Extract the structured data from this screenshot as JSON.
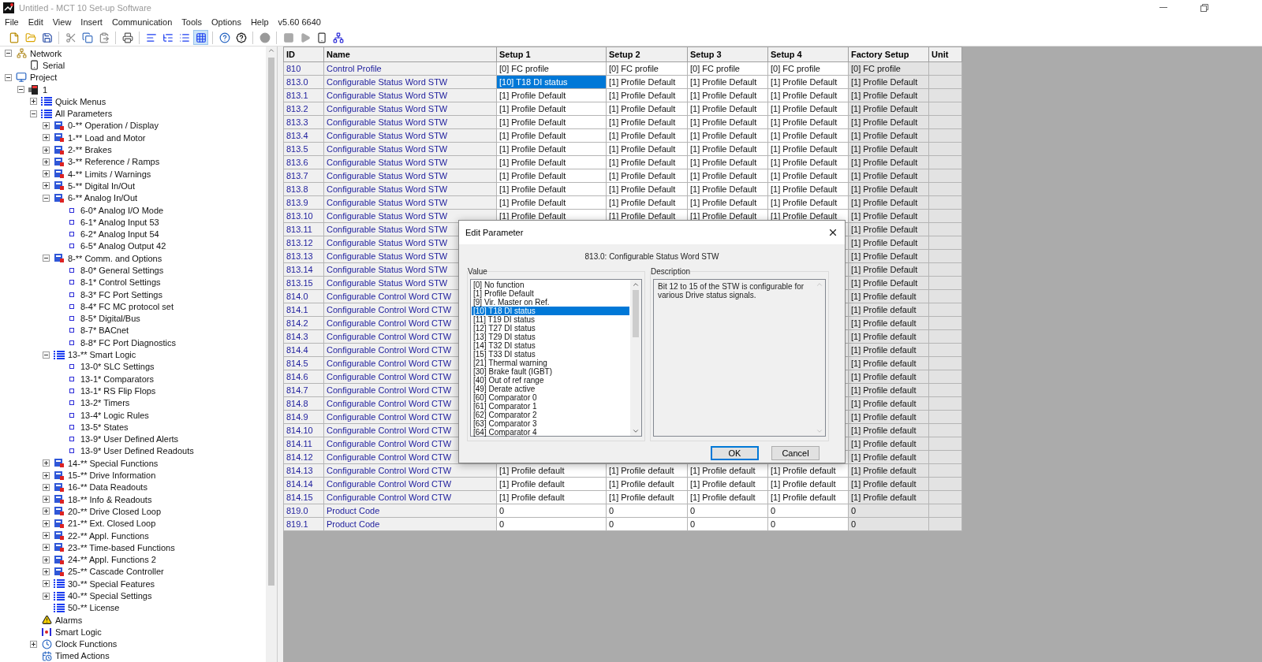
{
  "window": {
    "title": "Untitled - MCT 10 Set-up Software"
  },
  "menu": [
    "File",
    "Edit",
    "View",
    "Insert",
    "Communication",
    "Tools",
    "Options",
    "Help",
    "v5.60 6640"
  ],
  "toolbar": {
    "views": [
      {
        "selected": false
      },
      {
        "selected": false
      },
      {
        "selected": false
      },
      {
        "selected": true
      }
    ]
  },
  "tree": [
    {
      "label": "Network",
      "kind": "network",
      "expanded": true,
      "children": [
        {
          "label": "Serial",
          "kind": "device"
        }
      ]
    },
    {
      "label": "Project",
      "kind": "project",
      "expanded": true,
      "children": [
        {
          "label": "1",
          "kind": "drive",
          "expanded": true,
          "children": [
            {
              "label": "Quick Menus",
              "kind": "list",
              "expanded": false
            },
            {
              "label": "All Parameters",
              "kind": "list",
              "expanded": true,
              "children": [
                {
                  "label": "0-** Operation / Display",
                  "kind": "group",
                  "expanded": false
                },
                {
                  "label": "1-** Load and Motor",
                  "kind": "group",
                  "expanded": false
                },
                {
                  "label": "2-** Brakes",
                  "kind": "group",
                  "expanded": false
                },
                {
                  "label": "3-** Reference / Ramps",
                  "kind": "group",
                  "expanded": false
                },
                {
                  "label": "4-** Limits / Warnings",
                  "kind": "group",
                  "expanded": false
                },
                {
                  "label": "5-** Digital In/Out",
                  "kind": "group",
                  "expanded": false
                },
                {
                  "label": "6-** Analog In/Out",
                  "kind": "group",
                  "expanded": true,
                  "children": [
                    {
                      "label": "6-0* Analog I/O Mode",
                      "kind": "leaf"
                    },
                    {
                      "label": "6-1* Analog Input 53",
                      "kind": "leaf"
                    },
                    {
                      "label": "6-2* Analog Input 54",
                      "kind": "leaf"
                    },
                    {
                      "label": "6-5* Analog Output 42",
                      "kind": "leaf"
                    }
                  ]
                },
                {
                  "label": "8-** Comm. and Options",
                  "kind": "group",
                  "expanded": true,
                  "children": [
                    {
                      "label": "8-0* General Settings",
                      "kind": "leaf"
                    },
                    {
                      "label": "8-1* Control Settings",
                      "kind": "leaf"
                    },
                    {
                      "label": "8-3* FC Port Settings",
                      "kind": "leaf"
                    },
                    {
                      "label": "8-4* FC MC protocol set",
                      "kind": "leaf"
                    },
                    {
                      "label": "8-5* Digital/Bus",
                      "kind": "leaf"
                    },
                    {
                      "label": "8-7* BACnet",
                      "kind": "leaf"
                    },
                    {
                      "label": "8-8* FC Port Diagnostics",
                      "kind": "leaf"
                    }
                  ]
                },
                {
                  "label": "13-** Smart Logic",
                  "kind": "list",
                  "expanded": true,
                  "children": [
                    {
                      "label": "13-0* SLC Settings",
                      "kind": "leaf"
                    },
                    {
                      "label": "13-1* Comparators",
                      "kind": "leaf"
                    },
                    {
                      "label": "13-1* RS Flip Flops",
                      "kind": "leaf"
                    },
                    {
                      "label": "13-2* Timers",
                      "kind": "leaf"
                    },
                    {
                      "label": "13-4* Logic Rules",
                      "kind": "leaf"
                    },
                    {
                      "label": "13-5* States",
                      "kind": "leaf"
                    },
                    {
                      "label": "13-9* User Defined Alerts",
                      "kind": "leaf"
                    },
                    {
                      "label": "13-9* User Defined Readouts",
                      "kind": "leaf"
                    }
                  ]
                },
                {
                  "label": "14-** Special Functions",
                  "kind": "group",
                  "expanded": false
                },
                {
                  "label": "15-** Drive Information",
                  "kind": "group",
                  "expanded": false
                },
                {
                  "label": "16-** Data Readouts",
                  "kind": "group",
                  "expanded": false
                },
                {
                  "label": "18-** Info & Readouts",
                  "kind": "group",
                  "expanded": false
                },
                {
                  "label": "20-** Drive Closed Loop",
                  "kind": "group",
                  "expanded": false
                },
                {
                  "label": "21-** Ext. Closed Loop",
                  "kind": "group",
                  "expanded": false
                },
                {
                  "label": "22-** Appl. Functions",
                  "kind": "group",
                  "expanded": false
                },
                {
                  "label": "23-** Time-based Functions",
                  "kind": "group",
                  "expanded": false
                },
                {
                  "label": "24-** Appl. Functions 2",
                  "kind": "group",
                  "expanded": false
                },
                {
                  "label": "25-** Cascade Controller",
                  "kind": "group",
                  "expanded": false
                },
                {
                  "label": "30-** Special Features",
                  "kind": "list",
                  "expanded": false
                },
                {
                  "label": "40-** Special Settings",
                  "kind": "list",
                  "expanded": false
                },
                {
                  "label": "50-** License",
                  "kind": "list"
                }
              ]
            },
            {
              "label": "Alarms",
              "kind": "alarm"
            },
            {
              "label": "Smart Logic",
              "kind": "logic"
            },
            {
              "label": "Clock Functions",
              "kind": "clock",
              "expanded": false
            },
            {
              "label": "Timed Actions",
              "kind": "timed"
            }
          ]
        }
      ]
    }
  ],
  "table": {
    "columns": [
      "ID",
      "Name",
      "Setup 1",
      "Setup 2",
      "Setup 3",
      "Setup 4",
      "Factory Setup",
      "Unit"
    ],
    "rows": [
      {
        "id": "810",
        "name": "Control Profile",
        "setups": [
          {
            "text": "[0] FC profile",
            "selected": false
          },
          {
            "text": "[0] FC profile",
            "selected": false
          },
          {
            "text": "[0] FC profile",
            "selected": false
          },
          {
            "text": "[0] FC profile",
            "selected": false
          }
        ],
        "factory": "[0] FC profile"
      },
      {
        "id": "813.0",
        "name": "Configurable Status Word STW",
        "setups": [
          {
            "text": "[10] T18 DI status",
            "selected": true
          },
          {
            "text": "[1] Profile Default",
            "selected": false
          },
          {
            "text": "[1] Profile Default",
            "selected": false
          },
          {
            "text": "[1] Profile Default",
            "selected": false
          }
        ],
        "factory": "[1] Profile Default"
      },
      {
        "id": "813.1",
        "name": "Configurable Status Word STW",
        "setups": [
          {
            "text": "[1] Profile Default",
            "selected": false
          },
          {
            "text": "[1] Profile Default",
            "selected": false
          },
          {
            "text": "[1] Profile Default",
            "selected": false
          },
          {
            "text": "[1] Profile Default",
            "selected": false
          }
        ],
        "factory": "[1] Profile Default"
      },
      {
        "id": "813.2",
        "name": "Configurable Status Word STW",
        "setups": [
          {
            "text": "[1] Profile Default",
            "selected": false
          },
          {
            "text": "[1] Profile Default",
            "selected": false
          },
          {
            "text": "[1] Profile Default",
            "selected": false
          },
          {
            "text": "[1] Profile Default",
            "selected": false
          }
        ],
        "factory": "[1] Profile Default"
      },
      {
        "id": "813.3",
        "name": "Configurable Status Word STW",
        "setups": [
          {
            "text": "[1] Profile Default",
            "selected": false
          },
          {
            "text": "[1] Profile Default",
            "selected": false
          },
          {
            "text": "[1] Profile Default",
            "selected": false
          },
          {
            "text": "[1] Profile Default",
            "selected": false
          }
        ],
        "factory": "[1] Profile Default"
      },
      {
        "id": "813.4",
        "name": "Configurable Status Word STW",
        "setups": [
          {
            "text": "[1] Profile Default",
            "selected": false
          },
          {
            "text": "[1] Profile Default",
            "selected": false
          },
          {
            "text": "[1] Profile Default",
            "selected": false
          },
          {
            "text": "[1] Profile Default",
            "selected": false
          }
        ],
        "factory": "[1] Profile Default"
      },
      {
        "id": "813.5",
        "name": "Configurable Status Word STW",
        "setups": [
          {
            "text": "[1] Profile Default",
            "selected": false
          },
          {
            "text": "[1] Profile Default",
            "selected": false
          },
          {
            "text": "[1] Profile Default",
            "selected": false
          },
          {
            "text": "[1] Profile Default",
            "selected": false
          }
        ],
        "factory": "[1] Profile Default"
      },
      {
        "id": "813.6",
        "name": "Configurable Status Word STW",
        "setups": [
          {
            "text": "[1] Profile Default",
            "selected": false
          },
          {
            "text": "[1] Profile Default",
            "selected": false
          },
          {
            "text": "[1] Profile Default",
            "selected": false
          },
          {
            "text": "[1] Profile Default",
            "selected": false
          }
        ],
        "factory": "[1] Profile Default"
      },
      {
        "id": "813.7",
        "name": "Configurable Status Word STW",
        "setups": [
          {
            "text": "[1] Profile Default",
            "selected": false
          },
          {
            "text": "[1] Profile Default",
            "selected": false
          },
          {
            "text": "[1] Profile Default",
            "selected": false
          },
          {
            "text": "[1] Profile Default",
            "selected": false
          }
        ],
        "factory": "[1] Profile Default"
      },
      {
        "id": "813.8",
        "name": "Configurable Status Word STW",
        "setups": [
          {
            "text": "[1] Profile Default",
            "selected": false
          },
          {
            "text": "[1] Profile Default",
            "selected": false
          },
          {
            "text": "[1] Profile Default",
            "selected": false
          },
          {
            "text": "[1] Profile Default",
            "selected": false
          }
        ],
        "factory": "[1] Profile Default"
      },
      {
        "id": "813.9",
        "name": "Configurable Status Word STW",
        "setups": [
          {
            "text": "[1] Profile Default",
            "selected": false
          },
          {
            "text": "[1] Profile Default",
            "selected": false
          },
          {
            "text": "[1] Profile Default",
            "selected": false
          },
          {
            "text": "[1] Profile Default",
            "selected": false
          }
        ],
        "factory": "[1] Profile Default"
      },
      {
        "id": "813.10",
        "name": "Configurable Status Word STW",
        "setups": [
          {
            "text": "[1] Profile Default",
            "selected": false
          },
          {
            "text": "[1] Profile Default",
            "selected": false
          },
          {
            "text": "[1] Profile Default",
            "selected": false
          },
          {
            "text": "[1] Profile Default",
            "selected": false
          }
        ],
        "factory": "[1] Profile Default"
      },
      {
        "id": "813.11",
        "name": "Configurable Status Word STW",
        "factory": "[1] Profile Default"
      },
      {
        "id": "813.12",
        "name": "Configurable Status Word STW",
        "factory": "[1] Profile Default"
      },
      {
        "id": "813.13",
        "name": "Configurable Status Word STW",
        "factory": "[1] Profile Default"
      },
      {
        "id": "813.14",
        "name": "Configurable Status Word STW",
        "factory": "[1] Profile Default"
      },
      {
        "id": "813.15",
        "name": "Configurable Status Word STW",
        "factory": "[1] Profile Default"
      },
      {
        "id": "814.0",
        "name": "Configurable Control Word CTW",
        "factory": "[1] Profile default"
      },
      {
        "id": "814.1",
        "name": "Configurable Control Word CTW",
        "factory": "[1] Profile default"
      },
      {
        "id": "814.2",
        "name": "Configurable Control Word CTW",
        "factory": "[1] Profile default"
      },
      {
        "id": "814.3",
        "name": "Configurable Control Word CTW",
        "factory": "[1] Profile default"
      },
      {
        "id": "814.4",
        "name": "Configurable Control Word CTW",
        "factory": "[1] Profile default"
      },
      {
        "id": "814.5",
        "name": "Configurable Control Word CTW",
        "factory": "[1] Profile default"
      },
      {
        "id": "814.6",
        "name": "Configurable Control Word CTW",
        "factory": "[1] Profile default"
      },
      {
        "id": "814.7",
        "name": "Configurable Control Word CTW",
        "factory": "[1] Profile default"
      },
      {
        "id": "814.8",
        "name": "Configurable Control Word CTW",
        "factory": "[1] Profile default"
      },
      {
        "id": "814.9",
        "name": "Configurable Control Word CTW",
        "factory": "[1] Profile default"
      },
      {
        "id": "814.10",
        "name": "Configurable Control Word CTW",
        "factory": "[1] Profile default"
      },
      {
        "id": "814.11",
        "name": "Configurable Control Word CTW",
        "factory": "[1] Profile default"
      },
      {
        "id": "814.12",
        "name": "Configurable Control Word CTW",
        "factory": "[1] Profile default"
      },
      {
        "id": "814.13",
        "name": "Configurable Control Word CTW",
        "setups": [
          {
            "text": "[1] Profile default",
            "selected": false
          },
          {
            "text": "[1] Profile default",
            "selected": false
          },
          {
            "text": "[1] Profile default",
            "selected": false
          },
          {
            "text": "[1] Profile default",
            "selected": false
          }
        ],
        "factory": "[1] Profile default"
      },
      {
        "id": "814.14",
        "name": "Configurable Control Word CTW",
        "setups": [
          {
            "text": "[1] Profile default",
            "selected": false
          },
          {
            "text": "[1] Profile default",
            "selected": false
          },
          {
            "text": "[1] Profile default",
            "selected": false
          },
          {
            "text": "[1] Profile default",
            "selected": false
          }
        ],
        "factory": "[1] Profile default"
      },
      {
        "id": "814.15",
        "name": "Configurable Control Word CTW",
        "setups": [
          {
            "text": "[1] Profile default",
            "selected": false
          },
          {
            "text": "[1] Profile default",
            "selected": false
          },
          {
            "text": "[1] Profile default",
            "selected": false
          },
          {
            "text": "[1] Profile default",
            "selected": false
          }
        ],
        "factory": "[1] Profile default"
      },
      {
        "id": "819.0",
        "name": "Product Code",
        "setups": [
          {
            "text": "0",
            "selected": false
          },
          {
            "text": "0",
            "selected": false
          },
          {
            "text": "0",
            "selected": false
          },
          {
            "text": "0",
            "selected": false
          }
        ],
        "factory": "0"
      },
      {
        "id": "819.1",
        "name": "Product Code",
        "setups": [
          {
            "text": "0",
            "selected": false
          },
          {
            "text": "0",
            "selected": false
          },
          {
            "text": "0",
            "selected": false
          },
          {
            "text": "0",
            "selected": false
          }
        ],
        "factory": "0"
      }
    ]
  },
  "dialog": {
    "title": "Edit Parameter",
    "parameter": "813.0: Configurable Status Word STW",
    "value_label": "Value",
    "description_label": "Description",
    "options": [
      {
        "label": "[0] No function",
        "selected": false
      },
      {
        "label": "[1] Profile Default",
        "selected": false
      },
      {
        "label": "[9] Vir. Master on Ref.",
        "selected": false
      },
      {
        "label": "[10] T18 DI status",
        "selected": true
      },
      {
        "label": "[11] T19 DI status",
        "selected": false
      },
      {
        "label": "[12] T27 DI status",
        "selected": false
      },
      {
        "label": "[13] T29 DI status",
        "selected": false
      },
      {
        "label": "[14] T32 DI status",
        "selected": false
      },
      {
        "label": "[15] T33 DI status",
        "selected": false
      },
      {
        "label": "[21] Thermal warning",
        "selected": false
      },
      {
        "label": "[30] Brake fault (IGBT)",
        "selected": false
      },
      {
        "label": "[40] Out of ref range",
        "selected": false
      },
      {
        "label": "[49] Derate active",
        "selected": false
      },
      {
        "label": "[60] Comparator 0",
        "selected": false
      },
      {
        "label": "[61] Comparator 1",
        "selected": false
      },
      {
        "label": "[62] Comparator 2",
        "selected": false
      },
      {
        "label": "[63] Comparator 3",
        "selected": false
      },
      {
        "label": "[64] Comparator 4",
        "selected": false
      }
    ],
    "description": "Bit 12 to 15 of the STW is configurable for various Drive status signals.",
    "buttons": [
      "OK",
      "Cancel"
    ]
  }
}
